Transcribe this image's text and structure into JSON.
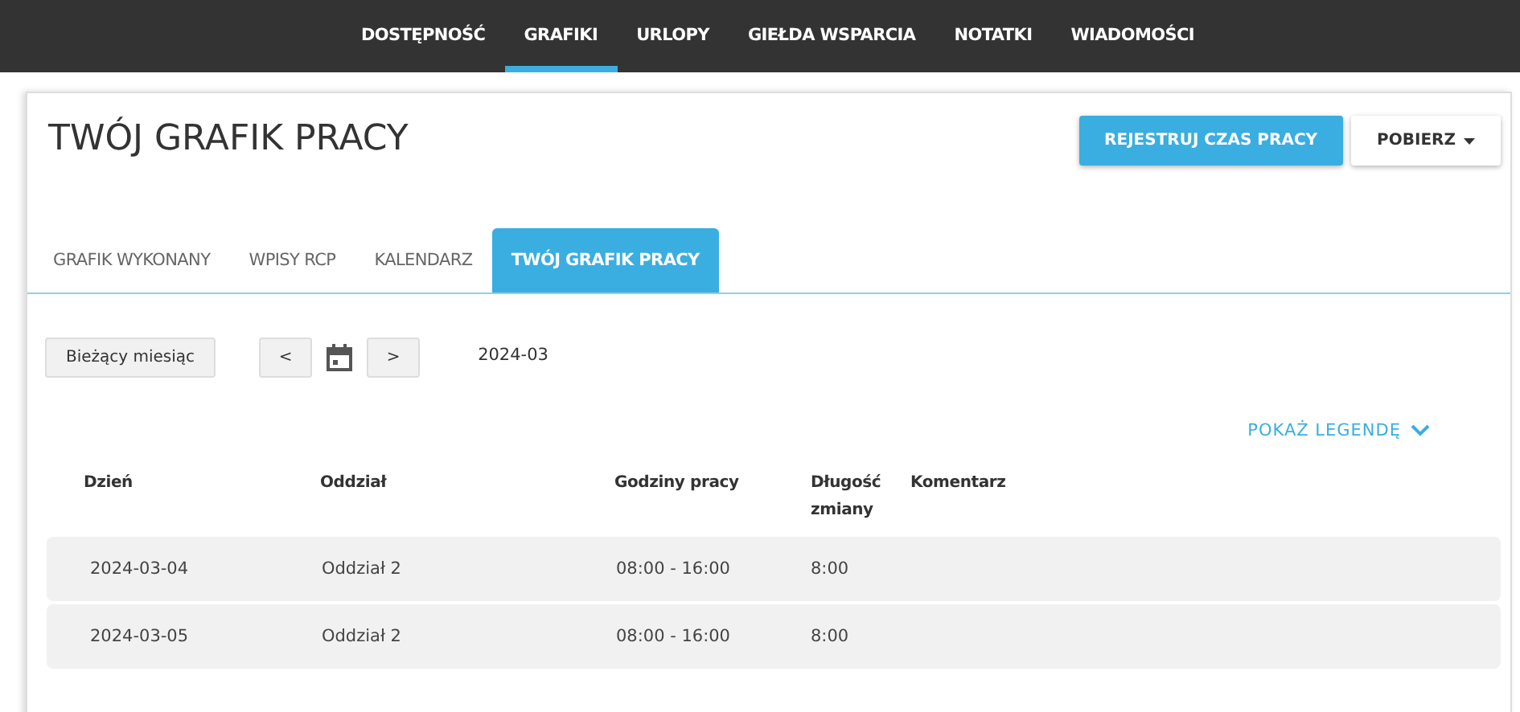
{
  "nav": [
    {
      "label": "DOSTĘPNOŚĆ",
      "selected": false
    },
    {
      "label": "GRAFIKI",
      "selected": true
    },
    {
      "label": "URLOPY",
      "selected": false
    },
    {
      "label": "GIEŁDA WSPARCIA",
      "selected": false
    },
    {
      "label": "NOTATKI",
      "selected": false
    },
    {
      "label": "WIADOMOŚCI",
      "selected": false
    }
  ],
  "page_title": "TWÓJ GRAFIK PRACY",
  "buttons": {
    "register": "REJESTRUJ CZAS PRACY",
    "download": "POBIERZ"
  },
  "tabs": [
    {
      "label": "GRAFIK WYKONANY",
      "selected": false
    },
    {
      "label": "WPISY RCP",
      "selected": false
    },
    {
      "label": "KALENDARZ",
      "selected": false
    },
    {
      "label": "TWÓJ GRAFIK PRACY",
      "selected": true
    }
  ],
  "toolbar": {
    "current_month": "Bieżący miesiąc",
    "prev": "<",
    "next": ">",
    "month": "2024-03"
  },
  "legend_toggle": "POKAŻ LEGENDĘ",
  "table": {
    "columns": [
      "Dzień",
      "Oddział",
      "Godziny pracy",
      "Długość zmiany",
      "Komentarz"
    ],
    "rows": [
      [
        "2024-03-04",
        "Oddział 2",
        "08:00 - 16:00",
        "8:00"
      ],
      [
        "2024-03-05",
        "Oddział 2",
        "08:00 - 16:00",
        "8:00"
      ]
    ]
  }
}
